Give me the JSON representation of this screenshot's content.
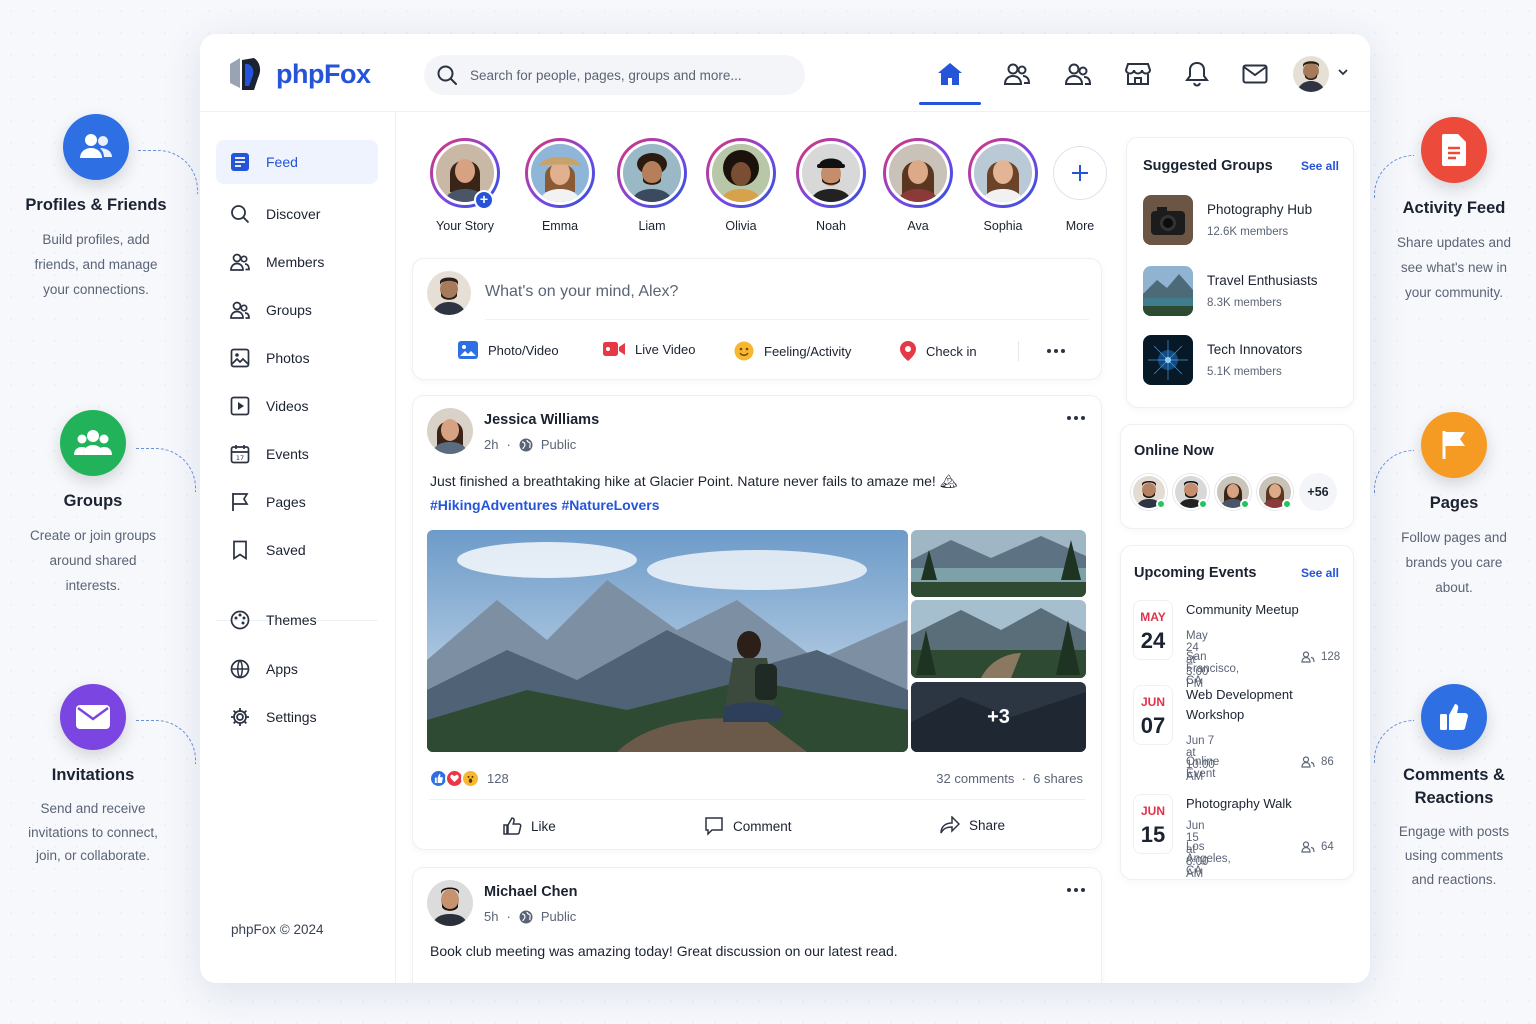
{
  "features": [
    {
      "title": "Profiles & Friends",
      "desc": [
        "Build profiles, add",
        "friends, and manage",
        "your connections."
      ],
      "color": "#2f6fe4",
      "icon": "users-icon"
    },
    {
      "title": "Groups",
      "desc": [
        "Create or join groups",
        "around shared",
        "interests."
      ],
      "color": "#22b35a",
      "icon": "group-icon"
    },
    {
      "title": "Invitations",
      "desc": [
        "Send and receive",
        "invitations to connect,",
        "join, or collaborate."
      ],
      "color": "#7a45e0",
      "icon": "envelope-icon"
    },
    {
      "title": "Activity Feed",
      "desc": [
        "Share updates and",
        "see what's new in",
        "your community."
      ],
      "color": "#ec4b3c",
      "icon": "document-icon"
    },
    {
      "title": "Pages",
      "desc": [
        "Follow pages and",
        "brands you care",
        "about."
      ],
      "color": "#f59a23",
      "icon": "flag-icon"
    },
    {
      "title": "Comments & Reactions",
      "title_lines": [
        "Comments &",
        "Reactions"
      ],
      "desc": [
        "Engage with posts",
        "using comments",
        "and reactions."
      ],
      "color": "#2f6fe4",
      "icon": "thumbs-up-icon"
    }
  ],
  "brand": {
    "name": "phpFox"
  },
  "search": {
    "placeholder": "Search for people, pages, groups and more..."
  },
  "sidebar": {
    "items": [
      {
        "label": "Feed",
        "icon": "feed-icon"
      },
      {
        "label": "Discover",
        "icon": "search-icon"
      },
      {
        "label": "Members",
        "icon": "members-icon"
      },
      {
        "label": "Groups",
        "icon": "groups-icon"
      },
      {
        "label": "Photos",
        "icon": "photo-icon"
      },
      {
        "label": "Videos",
        "icon": "video-icon"
      },
      {
        "label": "Events",
        "icon": "calendar-icon"
      },
      {
        "label": "Pages",
        "icon": "flag-icon"
      },
      {
        "label": "Saved",
        "icon": "bookmark-icon"
      },
      {
        "label": "Themes",
        "icon": "palette-icon"
      },
      {
        "label": "Apps",
        "icon": "apps-icon"
      },
      {
        "label": "Settings",
        "icon": "gear-icon"
      }
    ],
    "copyright": "phpFox © 2024"
  },
  "stories": [
    {
      "name": "Your Story"
    },
    {
      "name": "Emma"
    },
    {
      "name": "Liam"
    },
    {
      "name": "Olivia"
    },
    {
      "name": "Noah"
    },
    {
      "name": "Ava"
    },
    {
      "name": "Sophia"
    },
    {
      "name": "More"
    }
  ],
  "composer": {
    "placeholder": "What's on your mind, Alex?",
    "actions": [
      "Photo/Video",
      "Live Video",
      "Feeling/Activity",
      "Check in"
    ]
  },
  "posts": [
    {
      "author": "Jessica Williams",
      "time": "2h",
      "visibility": "Public",
      "text": "Just finished a breathtaking hike at Glacier Point. Nature never fails to amaze me! 🏔",
      "tags": "#HikingAdventures #NatureLovers",
      "extra_photos": "+3",
      "reactions": "128",
      "comments": "32 comments",
      "shares": "6 shares",
      "actions": [
        "Like",
        "Comment",
        "Share"
      ]
    },
    {
      "author": "Michael Chen",
      "time": "5h",
      "visibility": "Public",
      "text": "Book club meeting was amazing today! Great discussion on our latest read."
    }
  ],
  "suggested_groups": {
    "title": "Suggested Groups",
    "see_all": "See all",
    "items": [
      {
        "name": "Photography Hub",
        "members": "12.6K members"
      },
      {
        "name": "Travel Enthusiasts",
        "members": "8.3K members"
      },
      {
        "name": "Tech Innovators",
        "members": "5.1K members"
      }
    ]
  },
  "online_now": {
    "title": "Online Now",
    "more": "+56"
  },
  "events": {
    "title": "Upcoming Events",
    "see_all": "See all",
    "items": [
      {
        "month": "MAY",
        "day": "24",
        "title": "Community Meetup",
        "when": "May 24 at 3:00 PM",
        "where": "San Francisco, CA",
        "count": "128"
      },
      {
        "month": "JUN",
        "day": "07",
        "title": "Web Development Workshop",
        "when": "Jun 7 at 10:00 AM",
        "where": "Online Event",
        "count": "86"
      },
      {
        "month": "JUN",
        "day": "15",
        "title": "Photography Walk",
        "when": "Jun 15 at 8:00 AM",
        "where": "Los Angeles, CA",
        "count": "64"
      }
    ]
  }
}
